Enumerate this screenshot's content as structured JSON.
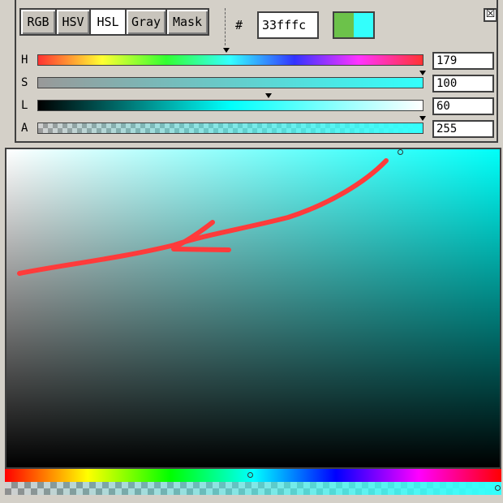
{
  "tabs": [
    {
      "label": "RGB",
      "active": false
    },
    {
      "label": "HSV",
      "active": false
    },
    {
      "label": "HSL",
      "active": true
    },
    {
      "label": "Gray",
      "active": false
    },
    {
      "label": "Mask",
      "active": false
    }
  ],
  "hex": {
    "symbol": "#",
    "value": "33fffc"
  },
  "swatch": {
    "previous_color": "#6cc24a",
    "current_color": "#33fffc"
  },
  "close_icon": "☒",
  "sliders": [
    {
      "key": "H",
      "label": "H",
      "value": "179",
      "fraction": 0.49
    },
    {
      "key": "S",
      "label": "S",
      "value": "100",
      "fraction": 1.0
    },
    {
      "key": "L",
      "label": "L",
      "value": "60",
      "fraction": 0.6
    },
    {
      "key": "A",
      "label": "A",
      "value": "255",
      "fraction": 1.0
    }
  ],
  "picker": {
    "hue_color": "#00fff9",
    "hue_fraction": 0.495,
    "alpha_fraction": 1.0,
    "annotation_color": "#ff3b3b"
  }
}
